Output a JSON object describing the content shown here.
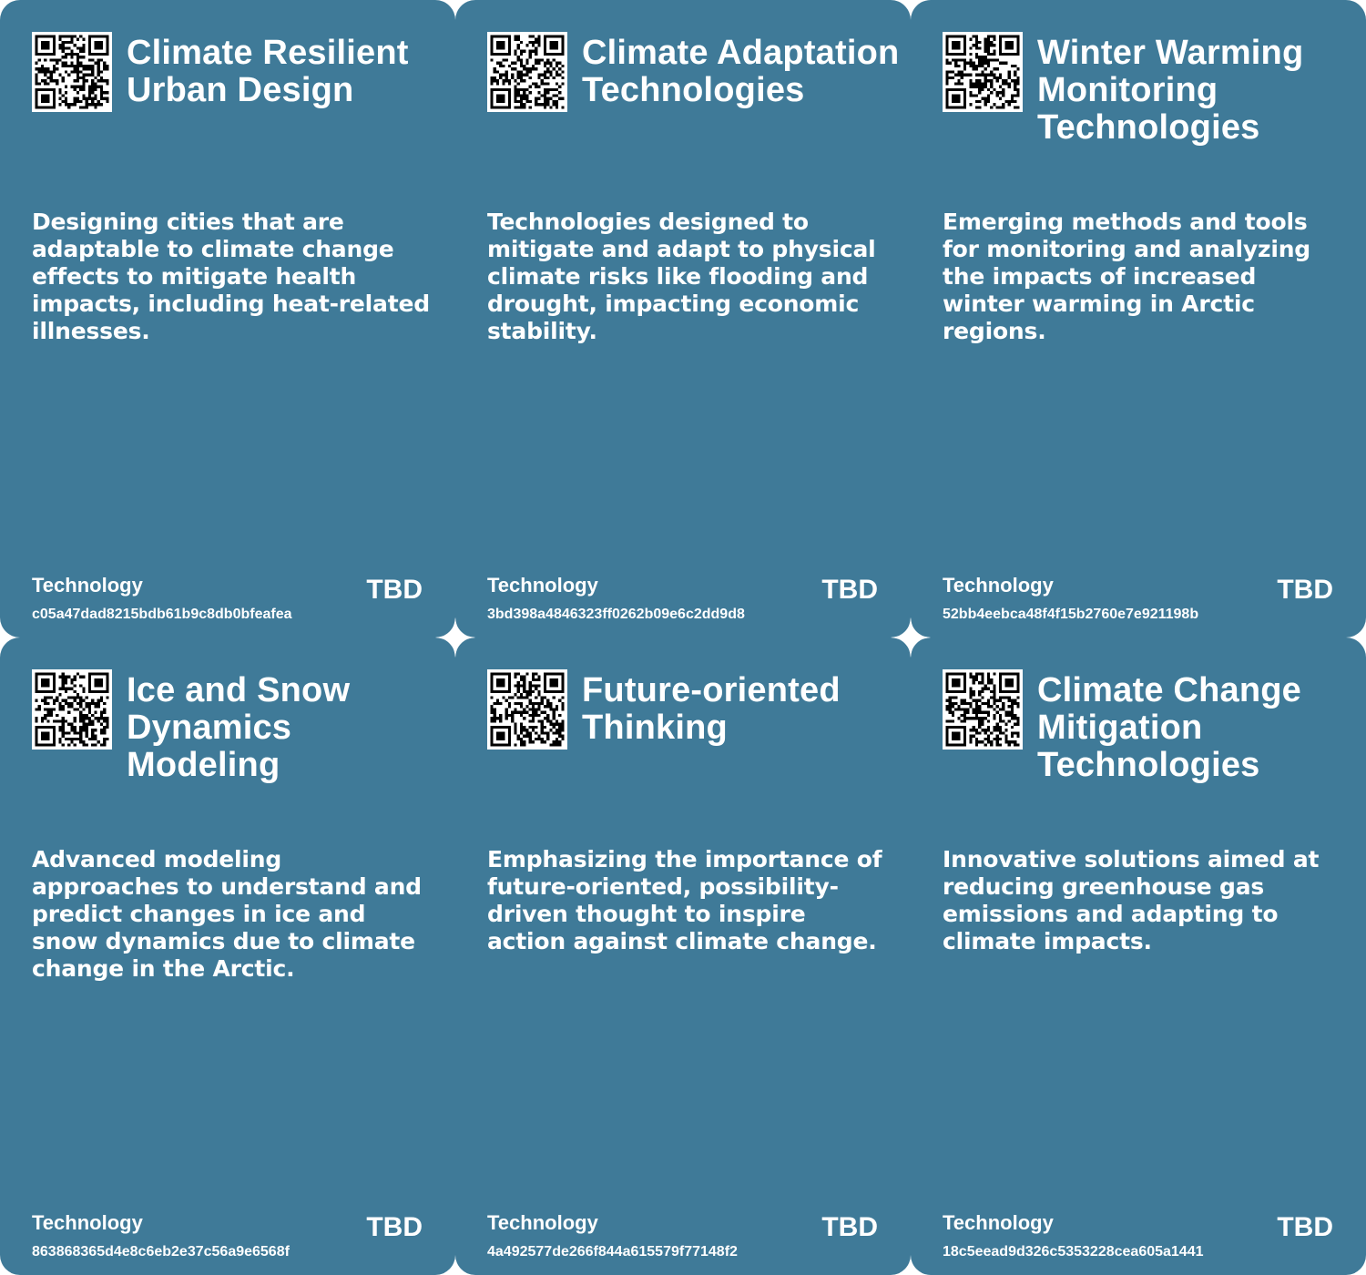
{
  "colors": {
    "card_bg": "#3f7a98",
    "text": "#ffffff",
    "page_bg": "#ffffff"
  },
  "cards": [
    {
      "title": "Climate Resilient Urban Design",
      "description": "Designing cities that are adaptable to climate change effects to mitigate health impacts, including heat-related illnesses.",
      "category": "Technology",
      "id": "c05a47dad8215bdb61b9c8db0bfeafea",
      "cost": "TBD",
      "icon": "qr-code-icon"
    },
    {
      "title": "Climate Adaptation Technologies",
      "description": "Technologies designed to mitigate and adapt to physical climate risks like flooding and drought, impacting economic stability.",
      "category": "Technology",
      "id": "3bd398a4846323ff0262b09e6c2dd9d8",
      "cost": "TBD",
      "icon": "qr-code-icon"
    },
    {
      "title": "Winter Warming Monitoring Technologies",
      "description": "Emerging methods and tools for monitoring and analyzing the impacts of increased winter warming in Arctic regions.",
      "category": "Technology",
      "id": "52bb4eebca48f4f15b2760e7e921198b",
      "cost": "TBD",
      "icon": "qr-code-icon"
    },
    {
      "title": "Ice and Snow Dynamics Modeling",
      "description": "Advanced modeling approaches to understand and predict changes in ice and snow dynamics due to climate change in the Arctic.",
      "category": "Technology",
      "id": "863868365d4e8c6eb2e37c56a9e6568f",
      "cost": "TBD",
      "icon": "qr-code-icon"
    },
    {
      "title": "Future-oriented Thinking",
      "description": "Emphasizing the importance of future-oriented, possibility-driven thought to inspire action against climate change.",
      "category": "Technology",
      "id": "4a492577de266f844a615579f77148f2",
      "cost": "TBD",
      "icon": "qr-code-icon"
    },
    {
      "title": "Climate Change Mitigation Technologies",
      "description": "Innovative solutions aimed at reducing greenhouse gas emissions and adapting to climate impacts.",
      "category": "Technology",
      "id": "18c5eead9d326c5353228cea605a1441",
      "cost": "TBD",
      "icon": "qr-code-icon"
    }
  ]
}
